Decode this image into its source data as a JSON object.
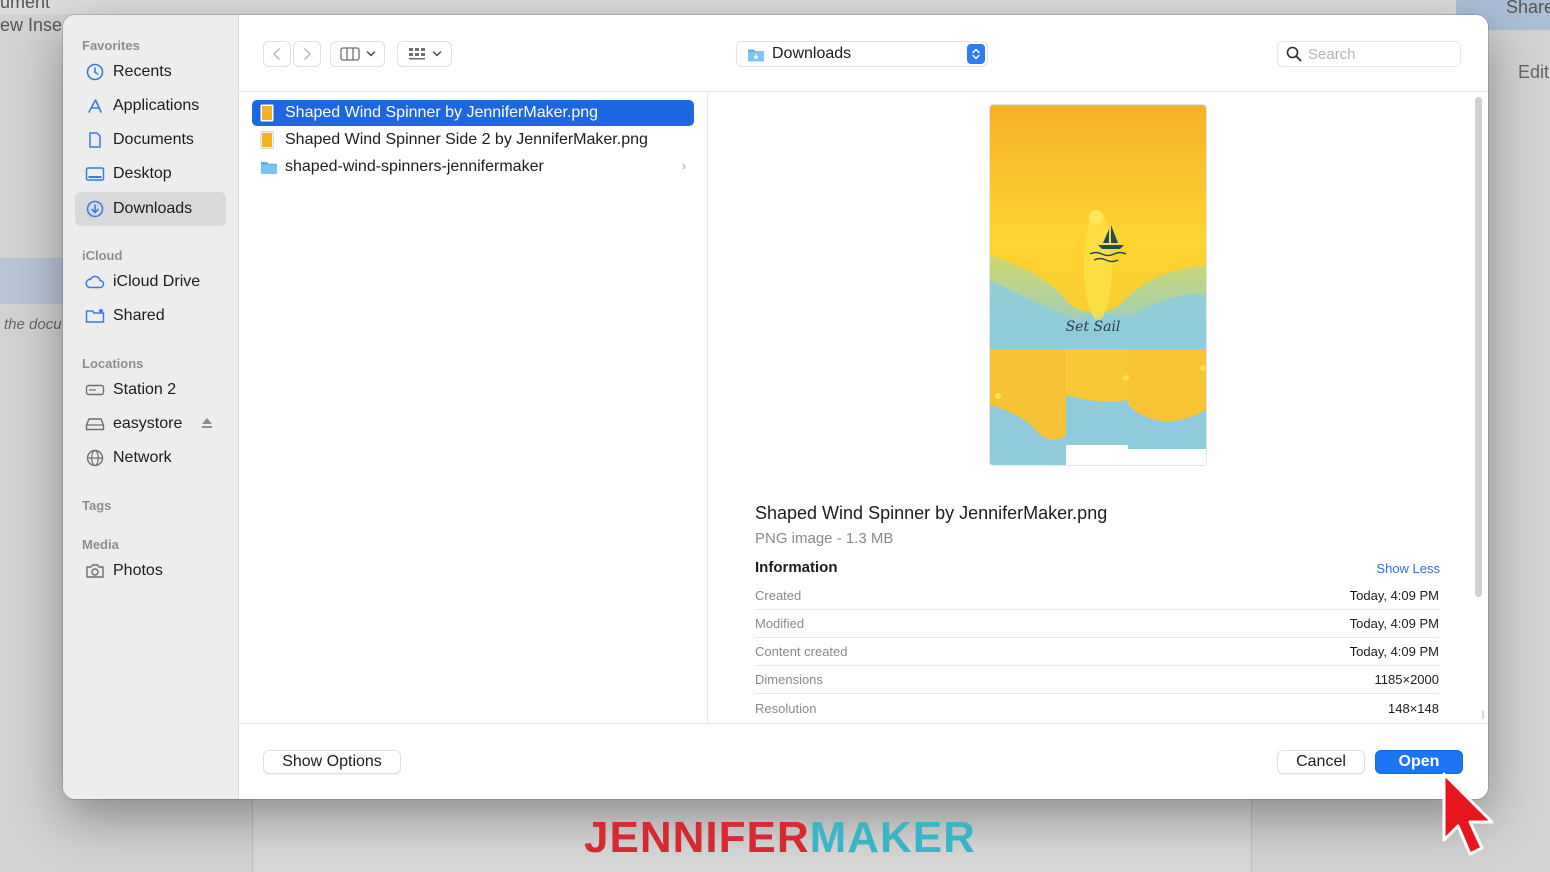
{
  "background": {
    "menu_left_1": "ument",
    "menu_left_2": "ew   Inse",
    "doc_hint": "the docu",
    "share_label": "Share",
    "edit_label": "Edit"
  },
  "sidebar": {
    "sections": [
      {
        "title": "Favorites",
        "items": [
          {
            "label": "Recents",
            "icon": "clock-icon"
          },
          {
            "label": "Applications",
            "icon": "applications-icon"
          },
          {
            "label": "Documents",
            "icon": "document-icon"
          },
          {
            "label": "Desktop",
            "icon": "desktop-icon"
          },
          {
            "label": "Downloads",
            "icon": "downloads-icon",
            "selected": true
          }
        ]
      },
      {
        "title": "iCloud",
        "items": [
          {
            "label": "iCloud Drive",
            "icon": "cloud-icon"
          },
          {
            "label": "Shared",
            "icon": "shared-folder-icon"
          }
        ]
      },
      {
        "title": "Locations",
        "items": [
          {
            "label": "Station 2",
            "icon": "drive-icon"
          },
          {
            "label": "easystore",
            "icon": "external-drive-icon"
          },
          {
            "label": "Network",
            "icon": "globe-icon"
          }
        ]
      },
      {
        "title": "Tags",
        "items": []
      },
      {
        "title": "Media",
        "items": [
          {
            "label": "Photos",
            "icon": "camera-icon"
          }
        ]
      }
    ]
  },
  "toolbar": {
    "location": "Downloads",
    "search_placeholder": "Search"
  },
  "files": [
    {
      "name": "Shaped Wind Spinner by JenniferMaker.png",
      "type": "image",
      "selected": true
    },
    {
      "name": "Shaped Wind Spinner Side 2 by JenniferMaker.png",
      "type": "image",
      "selected": false
    },
    {
      "name": "shaped-wind-spinners-jennifermaker",
      "type": "folder",
      "selected": false
    }
  ],
  "preview": {
    "image_text": "Set Sail",
    "name": "Shaped Wind Spinner by JenniferMaker.png",
    "kind": "PNG image - 1.3 MB",
    "info_title": "Information",
    "show_less": "Show Less",
    "info": [
      {
        "label": "Created",
        "value": "Today, 4:09 PM"
      },
      {
        "label": "Modified",
        "value": "Today, 4:09 PM"
      },
      {
        "label": "Content created",
        "value": "Today, 4:09 PM"
      },
      {
        "label": "Dimensions",
        "value": "1185×2000"
      },
      {
        "label": "Resolution",
        "value": "148×148"
      }
    ]
  },
  "buttons": {
    "show_options": "Show Options",
    "cancel": "Cancel",
    "open": "Open"
  },
  "brand": {
    "part1": "JENNIFER",
    "part2": "MAKER"
  },
  "colors": {
    "accent": "#1d74f5",
    "selection": "#1d67e2",
    "brand_red": "#d42a32",
    "brand_teal": "#3bb5c6"
  }
}
